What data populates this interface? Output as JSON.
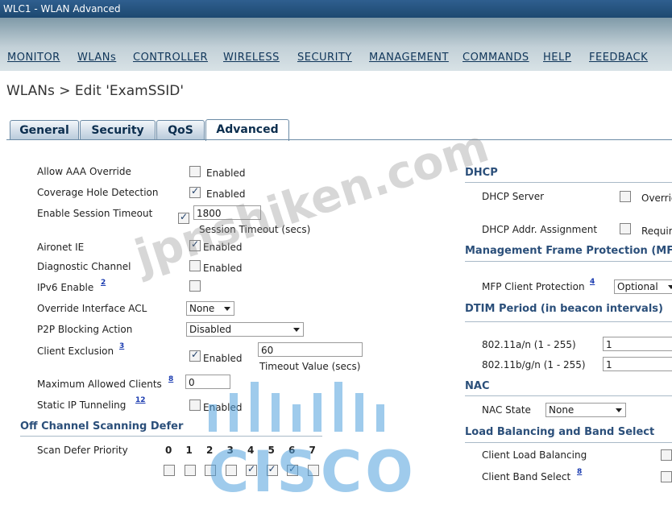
{
  "window": {
    "title": "WLC1 - WLAN Advanced"
  },
  "menu": [
    "MONITOR",
    "WLANs",
    "CONTROLLER",
    "WIRELESS",
    "SECURITY",
    "MANAGEMENT",
    "COMMANDS",
    "HELP",
    "FEEDBACK"
  ],
  "breadcrumb": "WLANs > Edit  'ExamSSID'",
  "tabs": [
    "General",
    "Security",
    "QoS",
    "Advanced"
  ],
  "active_tab": "Advanced",
  "left": {
    "allow_aaa_override": {
      "label": "Allow AAA Override",
      "checked": false,
      "text": "Enabled"
    },
    "coverage_hole_detection": {
      "label": "Coverage Hole Detection",
      "checked": true,
      "text": "Enabled"
    },
    "session_timeout": {
      "label": "Enable Session Timeout",
      "checked": true,
      "value": "1800",
      "caption": "Session Timeout (secs)"
    },
    "aironet_ie": {
      "label": "Aironet IE",
      "checked": true,
      "text": "Enabled"
    },
    "diagnostic_channel": {
      "label": "Diagnostic Channel",
      "checked": false,
      "text": "Enabled"
    },
    "ipv6_enable": {
      "label": "IPv6 Enable",
      "footnote": "2",
      "checked": false
    },
    "override_interface_acl": {
      "label": "Override Interface ACL",
      "value": "None"
    },
    "p2p_blocking": {
      "label": "P2P Blocking Action",
      "value": "Disabled"
    },
    "client_exclusion": {
      "label": "Client Exclusion",
      "footnote": "3",
      "checked": true,
      "text": "Enabled",
      "value": "60",
      "caption": "Timeout Value (secs)"
    },
    "max_clients": {
      "label": "Maximum Allowed Clients",
      "footnote": "8",
      "value": "0"
    },
    "static_ip_tunneling": {
      "label": "Static IP Tunneling",
      "footnote": "12",
      "checked": false,
      "text": "Enabled"
    },
    "off_channel": {
      "heading": "Off Channel Scanning Defer",
      "label": "Scan Defer Priority",
      "priorities": [
        "0",
        "1",
        "2",
        "3",
        "4",
        "5",
        "6",
        "7"
      ],
      "checked": [
        false,
        false,
        false,
        false,
        true,
        true,
        true,
        false
      ]
    }
  },
  "right": {
    "dhcp": {
      "heading": "DHCP",
      "server_label": "DHCP Server",
      "server_text": "Override",
      "addr_label": "DHCP Addr. Assignment",
      "addr_text": "Required"
    },
    "mfp": {
      "heading": "Management Frame Protection (MFP)",
      "label": "MFP Client Protection",
      "footnote": "4",
      "value": "Optional"
    },
    "dtim": {
      "heading": "DTIM Period (in beacon intervals)",
      "a_label": "802.11a/n (1 - 255)",
      "a_value": "1",
      "bg_label": "802.11b/g/n (1 - 255)",
      "bg_value": "1"
    },
    "nac": {
      "heading": "NAC",
      "label": "NAC State",
      "value": "None"
    },
    "lb": {
      "heading": "Load Balancing and Band Select",
      "lb_label": "Client Load Balancing",
      "bs_label": "Client Band Select",
      "bs_footnote": "8"
    }
  },
  "watermark": "jpnshiken.com",
  "logo_text": "CISCO"
}
